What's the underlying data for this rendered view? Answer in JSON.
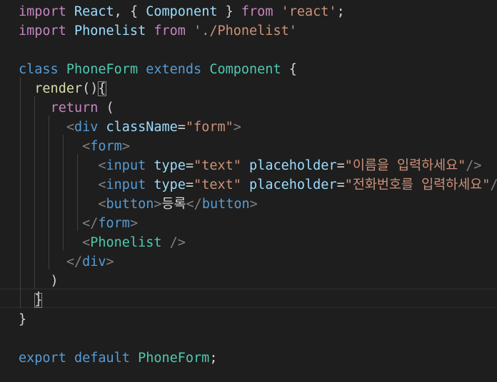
{
  "editor": {
    "lines": [
      {
        "tokens": [
          {
            "t": "kw",
            "v": "import"
          },
          {
            "t": "plain",
            "v": " "
          },
          {
            "t": "id",
            "v": "React"
          },
          {
            "t": "plain",
            "v": ", { "
          },
          {
            "t": "id",
            "v": "Component"
          },
          {
            "t": "plain",
            "v": " } "
          },
          {
            "t": "kw",
            "v": "from"
          },
          {
            "t": "plain",
            "v": " "
          },
          {
            "t": "str",
            "v": "'react'"
          },
          {
            "t": "plain",
            "v": ";"
          }
        ]
      },
      {
        "tokens": [
          {
            "t": "kw",
            "v": "import"
          },
          {
            "t": "plain",
            "v": " "
          },
          {
            "t": "id",
            "v": "Phonelist"
          },
          {
            "t": "plain",
            "v": " "
          },
          {
            "t": "kw",
            "v": "from"
          },
          {
            "t": "plain",
            "v": " "
          },
          {
            "t": "str",
            "v": "'./Phonelist'"
          }
        ]
      },
      {
        "tokens": []
      },
      {
        "tokens": [
          {
            "t": "kwb",
            "v": "class"
          },
          {
            "t": "plain",
            "v": " "
          },
          {
            "t": "cls",
            "v": "PhoneForm"
          },
          {
            "t": "plain",
            "v": " "
          },
          {
            "t": "kwb",
            "v": "extends"
          },
          {
            "t": "plain",
            "v": " "
          },
          {
            "t": "cls",
            "v": "Component"
          },
          {
            "t": "plain",
            "v": " {"
          }
        ]
      },
      {
        "tokens": [
          {
            "t": "plain",
            "v": "  "
          },
          {
            "t": "fn",
            "v": "render"
          },
          {
            "t": "plain",
            "v": "()"
          },
          {
            "t": "brk",
            "v": "{"
          }
        ]
      },
      {
        "tokens": [
          {
            "t": "plain",
            "v": "    "
          },
          {
            "t": "kw",
            "v": "return"
          },
          {
            "t": "plain",
            "v": " ("
          }
        ]
      },
      {
        "tokens": [
          {
            "t": "plain",
            "v": "      "
          },
          {
            "t": "ang",
            "v": "<"
          },
          {
            "t": "tag",
            "v": "div"
          },
          {
            "t": "plain",
            "v": " "
          },
          {
            "t": "id",
            "v": "className"
          },
          {
            "t": "plain",
            "v": "="
          },
          {
            "t": "str",
            "v": "\"form\""
          },
          {
            "t": "ang",
            "v": ">"
          }
        ]
      },
      {
        "tokens": [
          {
            "t": "plain",
            "v": "        "
          },
          {
            "t": "ang",
            "v": "<"
          },
          {
            "t": "tag",
            "v": "form"
          },
          {
            "t": "ang",
            "v": ">"
          }
        ]
      },
      {
        "tokens": [
          {
            "t": "plain",
            "v": "          "
          },
          {
            "t": "ang",
            "v": "<"
          },
          {
            "t": "tag",
            "v": "input"
          },
          {
            "t": "plain",
            "v": " "
          },
          {
            "t": "id",
            "v": "type"
          },
          {
            "t": "plain",
            "v": "="
          },
          {
            "t": "str",
            "v": "\"text\""
          },
          {
            "t": "plain",
            "v": " "
          },
          {
            "t": "id",
            "v": "placeholder"
          },
          {
            "t": "plain",
            "v": "="
          },
          {
            "t": "str",
            "v": "\"이름을 입력하세요\""
          },
          {
            "t": "ang",
            "v": "/>"
          }
        ]
      },
      {
        "tokens": [
          {
            "t": "plain",
            "v": "          "
          },
          {
            "t": "ang",
            "v": "<"
          },
          {
            "t": "tag",
            "v": "input"
          },
          {
            "t": "plain",
            "v": " "
          },
          {
            "t": "id",
            "v": "type"
          },
          {
            "t": "plain",
            "v": "="
          },
          {
            "t": "str",
            "v": "\"text\""
          },
          {
            "t": "plain",
            "v": " "
          },
          {
            "t": "id",
            "v": "placeholder"
          },
          {
            "t": "plain",
            "v": "="
          },
          {
            "t": "str",
            "v": "\"전화번호를 입력하세요\""
          },
          {
            "t": "ang",
            "v": "/>"
          }
        ]
      },
      {
        "tokens": [
          {
            "t": "plain",
            "v": "          "
          },
          {
            "t": "ang",
            "v": "<"
          },
          {
            "t": "tag",
            "v": "button"
          },
          {
            "t": "ang",
            "v": ">"
          },
          {
            "t": "plain",
            "v": "등록"
          },
          {
            "t": "ang",
            "v": "</"
          },
          {
            "t": "tag",
            "v": "button"
          },
          {
            "t": "ang",
            "v": ">"
          }
        ]
      },
      {
        "tokens": [
          {
            "t": "plain",
            "v": "        "
          },
          {
            "t": "ang",
            "v": "</"
          },
          {
            "t": "tag",
            "v": "form"
          },
          {
            "t": "ang",
            "v": ">"
          }
        ]
      },
      {
        "tokens": [
          {
            "t": "plain",
            "v": "        "
          },
          {
            "t": "ang",
            "v": "<"
          },
          {
            "t": "cls",
            "v": "Phonelist"
          },
          {
            "t": "plain",
            "v": " "
          },
          {
            "t": "ang",
            "v": "/>"
          }
        ]
      },
      {
        "tokens": [
          {
            "t": "plain",
            "v": "      "
          },
          {
            "t": "ang",
            "v": "</"
          },
          {
            "t": "tag",
            "v": "div"
          },
          {
            "t": "ang",
            "v": ">"
          }
        ]
      },
      {
        "tokens": [
          {
            "t": "plain",
            "v": "    )"
          }
        ]
      },
      {
        "tokens": [
          {
            "t": "plain",
            "v": "  "
          },
          {
            "t": "brk",
            "v": "}"
          }
        ]
      },
      {
        "tokens": [
          {
            "t": "plain",
            "v": "}"
          }
        ]
      },
      {
        "tokens": []
      },
      {
        "tokens": [
          {
            "t": "kwb",
            "v": "export"
          },
          {
            "t": "plain",
            "v": " "
          },
          {
            "t": "kwb",
            "v": "default"
          },
          {
            "t": "plain",
            "v": " "
          },
          {
            "t": "cls",
            "v": "PhoneForm"
          },
          {
            "t": "plain",
            "v": ";"
          }
        ]
      }
    ]
  }
}
